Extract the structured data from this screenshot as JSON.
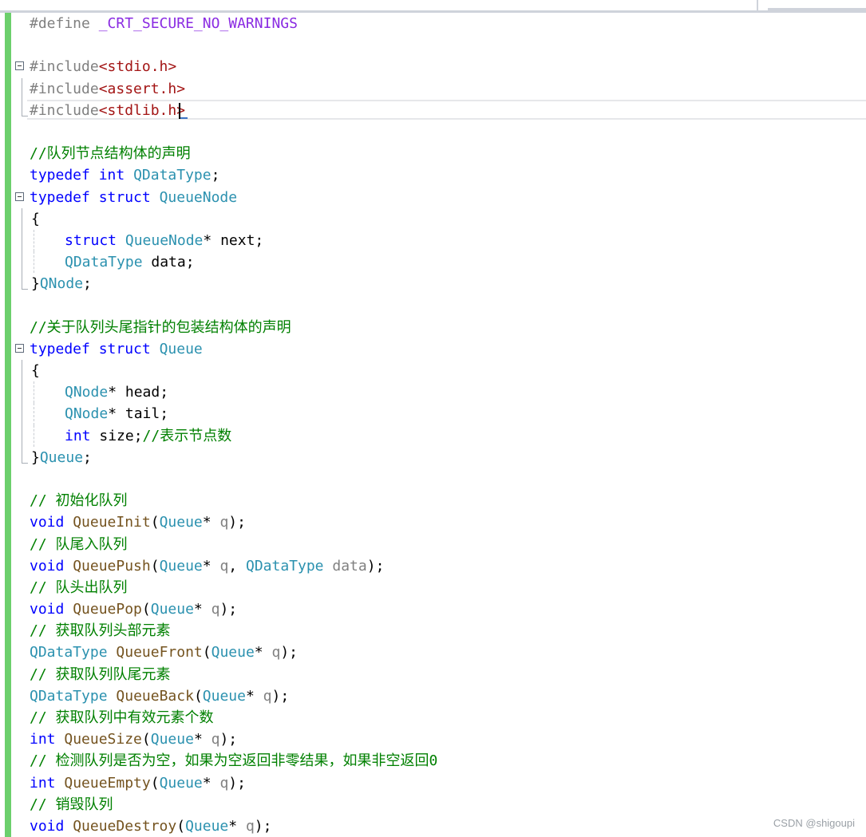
{
  "editor": {
    "lines": {
      "l01": {
        "a": "#define ",
        "b": "_CRT_SECURE_NO_WARNINGS"
      },
      "l03": {
        "a": "#include",
        "b": "<stdio.h>"
      },
      "l04": {
        "a": "#include",
        "b": "<assert.h>"
      },
      "l05": {
        "a": "#include",
        "b": "<stdlib.h",
        "c": ">"
      },
      "l07": {
        "a": "//队列节点结构体的声明"
      },
      "l08": {
        "a": "typedef ",
        "b": "int ",
        "c": "QDataType",
        "d": ";"
      },
      "l09": {
        "a": "typedef ",
        "b": "struct ",
        "c": "QueueNode"
      },
      "l10": {
        "a": "{"
      },
      "l11": {
        "a": "struct ",
        "b": "QueueNode",
        "c": "* next;"
      },
      "l12": {
        "a": "QDataType",
        "b": " data;"
      },
      "l13": {
        "a": "}",
        "b": "QNode",
        "c": ";"
      },
      "l15": {
        "a": "//关于队列头尾指针的包装结构体的声明"
      },
      "l16": {
        "a": "typedef ",
        "b": "struct ",
        "c": "Queue"
      },
      "l17": {
        "a": "{"
      },
      "l18": {
        "a": "QNode",
        "b": "* head;"
      },
      "l19": {
        "a": "QNode",
        "b": "* tail;"
      },
      "l20": {
        "a": "int ",
        "b": "size;",
        "c": "//表示节点数"
      },
      "l21": {
        "a": "}",
        "b": "Queue",
        "c": ";"
      },
      "l23": {
        "a": "// 初始化队列"
      },
      "l24": {
        "a": "void ",
        "b": "QueueInit",
        "c": "(",
        "d": "Queue",
        "e": "* ",
        "f": "q",
        "g": ");"
      },
      "l25": {
        "a": "// 队尾入队列"
      },
      "l26": {
        "a": "void ",
        "b": "QueuePush",
        "c": "(",
        "d": "Queue",
        "e": "* ",
        "f": "q",
        "g": ", ",
        "h": "QDataType",
        "i": " ",
        "j": "data",
        "k": ");"
      },
      "l27": {
        "a": "// 队头出队列"
      },
      "l28": {
        "a": "void ",
        "b": "QueuePop",
        "c": "(",
        "d": "Queue",
        "e": "* ",
        "f": "q",
        "g": ");"
      },
      "l29": {
        "a": "// 获取队列头部元素"
      },
      "l30": {
        "a": "QDataType",
        "b": " ",
        "c": "QueueFront",
        "d": "(",
        "e": "Queue",
        "f": "* ",
        "g": "q",
        "h": ");"
      },
      "l31": {
        "a": "// 获取队列队尾元素"
      },
      "l32": {
        "a": "QDataType",
        "b": " ",
        "c": "QueueBack",
        "d": "(",
        "e": "Queue",
        "f": "* ",
        "g": "q",
        "h": ");"
      },
      "l33": {
        "a": "// 获取队列中有效元素个数"
      },
      "l34": {
        "a": "int ",
        "b": "QueueSize",
        "c": "(",
        "d": "Queue",
        "e": "* ",
        "f": "q",
        "g": ");"
      },
      "l35": {
        "a": "// 检测队列是否为空，如果为空返回非零结果，如果非空返回0"
      },
      "l36": {
        "a": "int ",
        "b": "QueueEmpty",
        "c": "(",
        "d": "Queue",
        "e": "* ",
        "f": "q",
        "g": ");"
      },
      "l37": {
        "a": "// 销毁队列"
      },
      "l38": {
        "a": "void ",
        "b": "QueueDestroy",
        "c": "(",
        "d": "Queue",
        "e": "* ",
        "f": "q",
        "g": ");"
      }
    }
  },
  "watermark": "CSDN @shigoupi"
}
